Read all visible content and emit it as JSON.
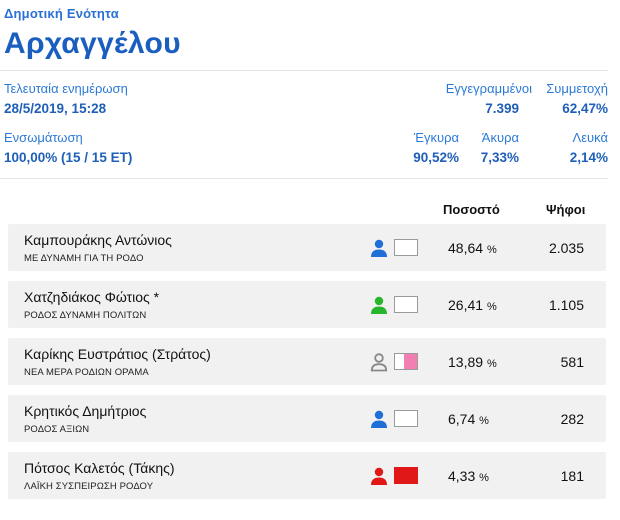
{
  "header": {
    "subtitle": "Δημοτική Ενότητα",
    "title": "Αρχαγγέλου"
  },
  "stats": {
    "last_update_label": "Τελευταία ενημέρωση",
    "last_update_value": "28/5/2019, 15:28",
    "registered_label": "Εγγεγραμμένοι",
    "registered_value": "7.399",
    "turnout_label": "Συμμετοχή",
    "turnout_value": "62,47%",
    "integration_label": "Ενσωμάτωση",
    "integration_value": "100,00% (15 / 15 ΕΤ)",
    "valid_label": "Έγκυρα",
    "valid_value": "90,52%",
    "invalid_label": "Άκυρα",
    "invalid_value": "7,33%",
    "blank_label": "Λευκά",
    "blank_value": "2,14%"
  },
  "table": {
    "col_percent": "Ποσοστό",
    "col_votes": "Ψήφοι",
    "rows": [
      {
        "name": "Καμπουράκης Αντώνιος",
        "party": "ΜΕ ΔΥΝΑΜΗ ΓΙΑ ΤΗ ΡΟΔΟ",
        "percent": "48,64",
        "unit": "%",
        "votes": "2.035",
        "icon": "person-icon",
        "icon_color": "#1f6fd6",
        "swatch_color": "#ffffff"
      },
      {
        "name": "Χατζηδιάκος Φώτιος *",
        "party": "ΡΟΔΟΣ ΔΥΝΑΜΗ ΠΟΛΙΤΩΝ",
        "percent": "26,41",
        "unit": "%",
        "votes": "1.105",
        "icon": "person-icon",
        "icon_color": "#27b52b",
        "swatch_color": "#ffffff"
      },
      {
        "name": "Καρίκης Ευστράτιος (Στράτος)",
        "party": "ΝΕΑ ΜΕΡΑ ΡΟΔΙΩΝ ΟΡΑΜΑ",
        "percent": "13,89",
        "unit": "%",
        "votes": "581",
        "icon": "person-outline-icon",
        "icon_color": "#888888",
        "swatch_color": "#f27fb2"
      },
      {
        "name": "Κρητικός Δημήτριος",
        "party": "ΡΟΔΟΣ ΑΞΙΩΝ",
        "percent": "6,74",
        "unit": "%",
        "votes": "282",
        "icon": "person-icon",
        "icon_color": "#1f6fd6",
        "swatch_color": "#ffffff"
      },
      {
        "name": "Πότσος Καλετός (Τάκης)",
        "party": "ΛΑΪΚΗ ΣΥΣΠΕΙΡΩΣΗ ΡΟΔΟΥ",
        "percent": "4,33",
        "unit": "%",
        "votes": "181",
        "icon": "person-icon",
        "icon_color": "#e01818",
        "swatch_color": "#e01818"
      }
    ]
  }
}
